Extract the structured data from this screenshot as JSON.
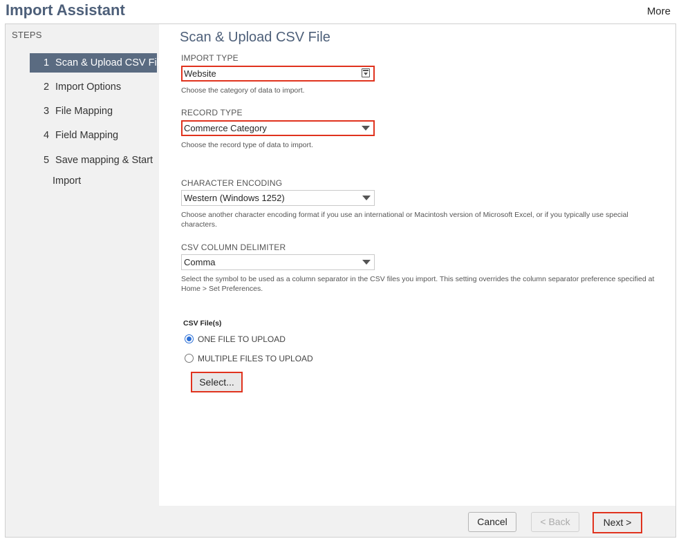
{
  "header": {
    "title": "Import Assistant",
    "more_label": "More"
  },
  "steps": {
    "title": "STEPS",
    "items": [
      {
        "num": "1",
        "label": "Scan & Upload CSV File"
      },
      {
        "num": "2",
        "label": "Import Options"
      },
      {
        "num": "3",
        "label": "File Mapping"
      },
      {
        "num": "4",
        "label": "Field Mapping"
      },
      {
        "num": "5",
        "label": "Save mapping & Start",
        "label2": "Import"
      }
    ]
  },
  "main": {
    "title": "Scan & Upload CSV File",
    "import_type": {
      "label": "IMPORT TYPE",
      "value": "Website",
      "help": "Choose the category of data to import."
    },
    "record_type": {
      "label": "RECORD TYPE",
      "value": "Commerce Category",
      "help": "Choose the record type of data to import."
    },
    "encoding": {
      "label": "CHARACTER ENCODING",
      "value": "Western (Windows 1252)",
      "help": "Choose another character encoding format if you use an international or Macintosh version of Microsoft Excel, or if you typically use special characters."
    },
    "delimiter": {
      "label": "CSV COLUMN DELIMITER",
      "value": "Comma",
      "help": "Select the symbol to be used as a column separator in the CSV files you import. This setting overrides the column separator preference specified at Home > Set Preferences."
    },
    "csv_files": {
      "label": "CSV File(s)",
      "option_one": "ONE FILE TO UPLOAD",
      "option_multiple": "MULTIPLE FILES TO UPLOAD",
      "select_label": "Select..."
    }
  },
  "footer": {
    "cancel_label": "Cancel",
    "back_label": "< Back",
    "next_label": "Next >"
  },
  "colors": {
    "highlight": "#e0321d",
    "active_step": "#5a6b81",
    "title": "#4d5f79",
    "radio_checked": "#2b6fd6"
  }
}
